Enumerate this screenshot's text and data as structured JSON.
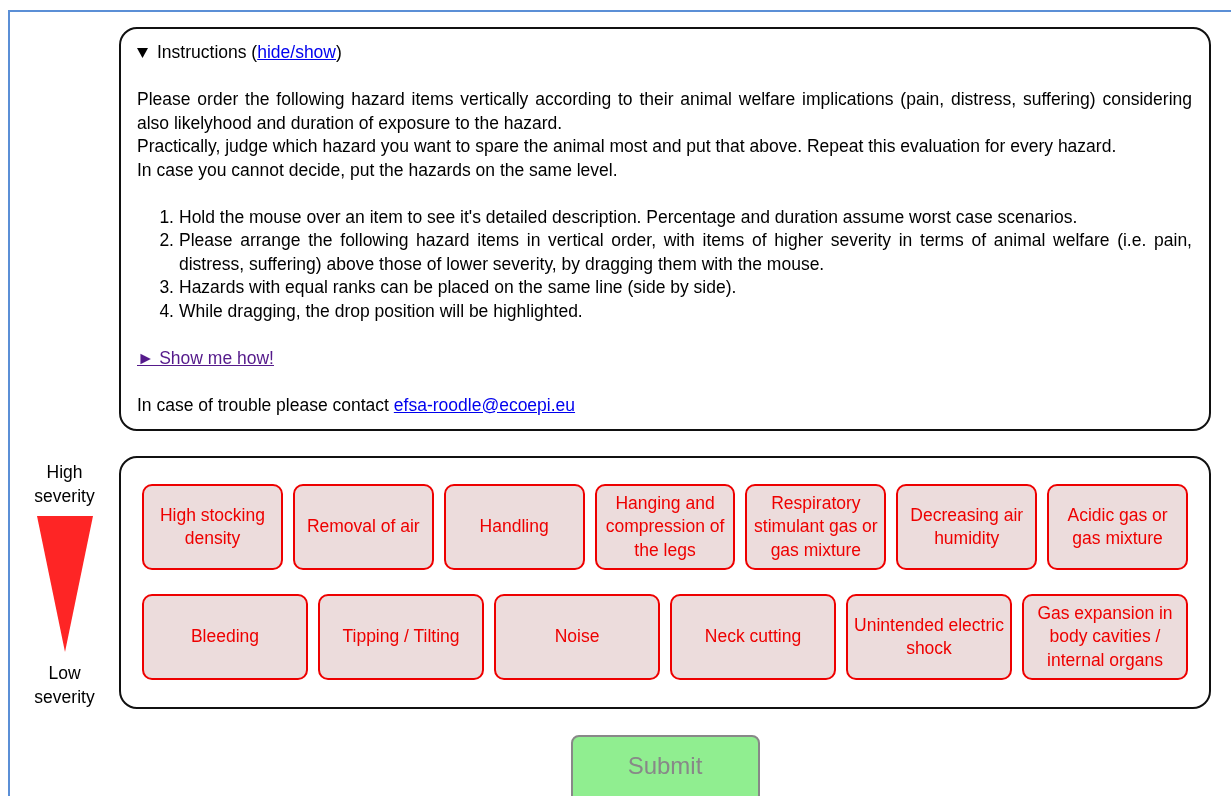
{
  "instructions": {
    "expanded": true,
    "title": "Instructions (",
    "title_link": "hide/show",
    "title_end": ")",
    "intro": [
      "Please order the following hazard items vertically according to their animal welfare implications (pain, distress, suffering) considering also likelyhood and duration of exposure to the hazard.",
      "Practically, judge which hazard you want to spare the animal most and put that above. Repeat this evaluation for every hazard.",
      "In case you cannot decide, put the hazards on the same level."
    ],
    "steps": [
      {
        "number": "1.",
        "text": "Hold the mouse over an item to see it's detailed description. Percentage and duration assume worst case scenarios."
      },
      {
        "number": "2.",
        "text": "Please arrange the following hazard items in vertical order, with items of higher severity in terms of animal welfare (i.e. pain, distress, suffering) above those of lower severity, by dragging them with the mouse."
      },
      {
        "number": "3.",
        "text": "Hazards with equal ranks can be placed on the same line (side by side)."
      },
      {
        "number": "4.",
        "text": "While dragging, the drop position will be highlighted."
      }
    ],
    "demo_link": "► Show me how!",
    "contact_text": "In case of trouble please contact ",
    "contact_link": "efsa-roodle@ecoepi.eu"
  },
  "severity": {
    "high": "High severity",
    "low": "Low severity"
  },
  "hazard_rows": [
    {
      "items": [
        "High stocking density",
        "Removal of air",
        "Handling",
        "Hanging and compression of the legs",
        "Respiratory stimulant gas or gas mixture",
        "Decreasing air humidity",
        "Acidic gas or gas mixture"
      ]
    },
    {
      "items": [
        "Bleeding",
        "Tipping / Tilting",
        "Noise",
        "Neck cutting",
        "Unintended electric shock",
        "Gas expansion in body cavities / internal organs"
      ]
    }
  ],
  "submit": {
    "label": "Submit",
    "disabled": true
  }
}
